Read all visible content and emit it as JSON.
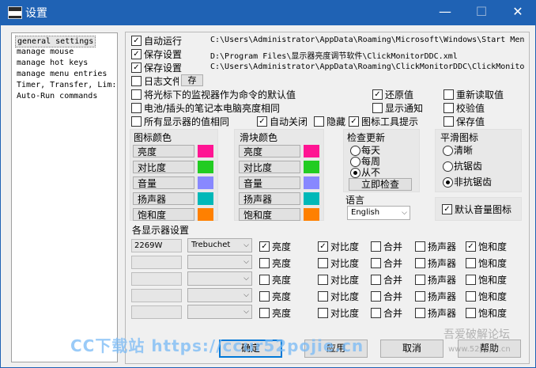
{
  "window": {
    "title": "设置",
    "min_glyph": "—",
    "max_glyph": "☐",
    "close_glyph": "✕"
  },
  "nav": [
    "general settings",
    "manage mouse",
    "manage hot keys",
    "manage menu entries",
    "Timer, Transfer, Lim:",
    "Auto-Run commands"
  ],
  "general": {
    "autorun": {
      "label": "自动运行",
      "checked": true,
      "path": "C:\\Users\\Administrator\\AppData\\Roaming\\Microsoft\\Windows\\Start Men"
    },
    "save1": {
      "label": "保存设置",
      "checked": true,
      "path": "D:\\Program Files\\显示器亮度调节软件\\ClickMonitorDDC.xml"
    },
    "save2": {
      "label": "保存设置",
      "checked": true,
      "path": "C:\\Users\\Administrator\\AppData\\Roaming\\ClickMonitorDDC\\ClickMonito"
    },
    "log": {
      "label": "日志文件",
      "checked": false,
      "button": "存"
    }
  },
  "options": [
    {
      "label": "将光标下的监视器作为命令的默认值",
      "checked": false
    },
    {
      "label": "还原值",
      "checked": true
    },
    {
      "label": "重新读取值",
      "checked": false
    },
    {
      "label": "电池/插头的笔记本电脑亮度相同",
      "checked": false
    },
    {
      "label": "显示通知",
      "checked": false
    },
    {
      "label": "校验值",
      "checked": false
    },
    {
      "label": "所有显示器的值相同",
      "checked": false
    },
    {
      "label": "自动关闭",
      "checked": true
    },
    {
      "label": "隐藏",
      "checked": false
    },
    {
      "label": "图标工具提示",
      "checked": true
    },
    {
      "label": "保存值",
      "checked": false
    }
  ],
  "icon_colors": {
    "title": "图标颜色",
    "items": [
      {
        "label": "亮度",
        "color": "#ff1493"
      },
      {
        "label": "对比度",
        "color": "#22cc22"
      },
      {
        "label": "音量",
        "color": "#8888ff"
      },
      {
        "label": "扬声器",
        "color": "#00b8b8"
      },
      {
        "label": "饱和度",
        "color": "#ff8000"
      }
    ]
  },
  "slider_colors": {
    "title": "滑块颜色",
    "items": [
      {
        "label": "亮度",
        "color": "#ff1493"
      },
      {
        "label": "对比度",
        "color": "#22cc22"
      },
      {
        "label": "音量",
        "color": "#8888ff"
      },
      {
        "label": "扬声器",
        "color": "#00b8b8"
      },
      {
        "label": "饱和度",
        "color": "#ff8000"
      }
    ]
  },
  "update": {
    "title": "检查更新",
    "options": [
      {
        "label": "每天",
        "selected": false
      },
      {
        "label": "每周",
        "selected": false
      },
      {
        "label": "从不",
        "selected": true
      }
    ],
    "check_now": "立即检查"
  },
  "language": {
    "title": "语言",
    "value": "English"
  },
  "smooth": {
    "title": "平滑图标",
    "options": [
      {
        "label": "清晰",
        "selected": false
      },
      {
        "label": "抗锯齿",
        "selected": false
      },
      {
        "label": "非抗锯齿",
        "selected": true
      }
    ]
  },
  "default_volume_icon": {
    "label": "默认音量图标",
    "checked": true
  },
  "monitors": {
    "title": "各显示器设置",
    "col_labels": [
      "亮度",
      "对比度",
      "合并",
      "扬声器",
      "饱和度"
    ],
    "rows": [
      {
        "name": "2269W",
        "font": "Trebuchet",
        "checks": [
          true,
          true,
          false,
          false,
          true
        ]
      },
      {
        "name": "",
        "font": "",
        "checks": [
          false,
          false,
          false,
          false,
          false
        ]
      },
      {
        "name": "",
        "font": "",
        "checks": [
          false,
          false,
          false,
          false,
          false
        ]
      },
      {
        "name": "",
        "font": "",
        "checks": [
          false,
          false,
          false,
          false,
          false
        ]
      },
      {
        "name": "",
        "font": "",
        "checks": [
          false,
          false,
          false,
          false,
          false
        ]
      }
    ]
  },
  "buttons": {
    "ok": "确定",
    "apply": "应用",
    "cancel": "取消",
    "help": "帮助"
  },
  "watermark": {
    "left": "CC下载站 https://ccur52pojie.cn",
    "right_top": "吾爱破解论坛",
    "right_bottom": "www.52pojie.cn"
  }
}
